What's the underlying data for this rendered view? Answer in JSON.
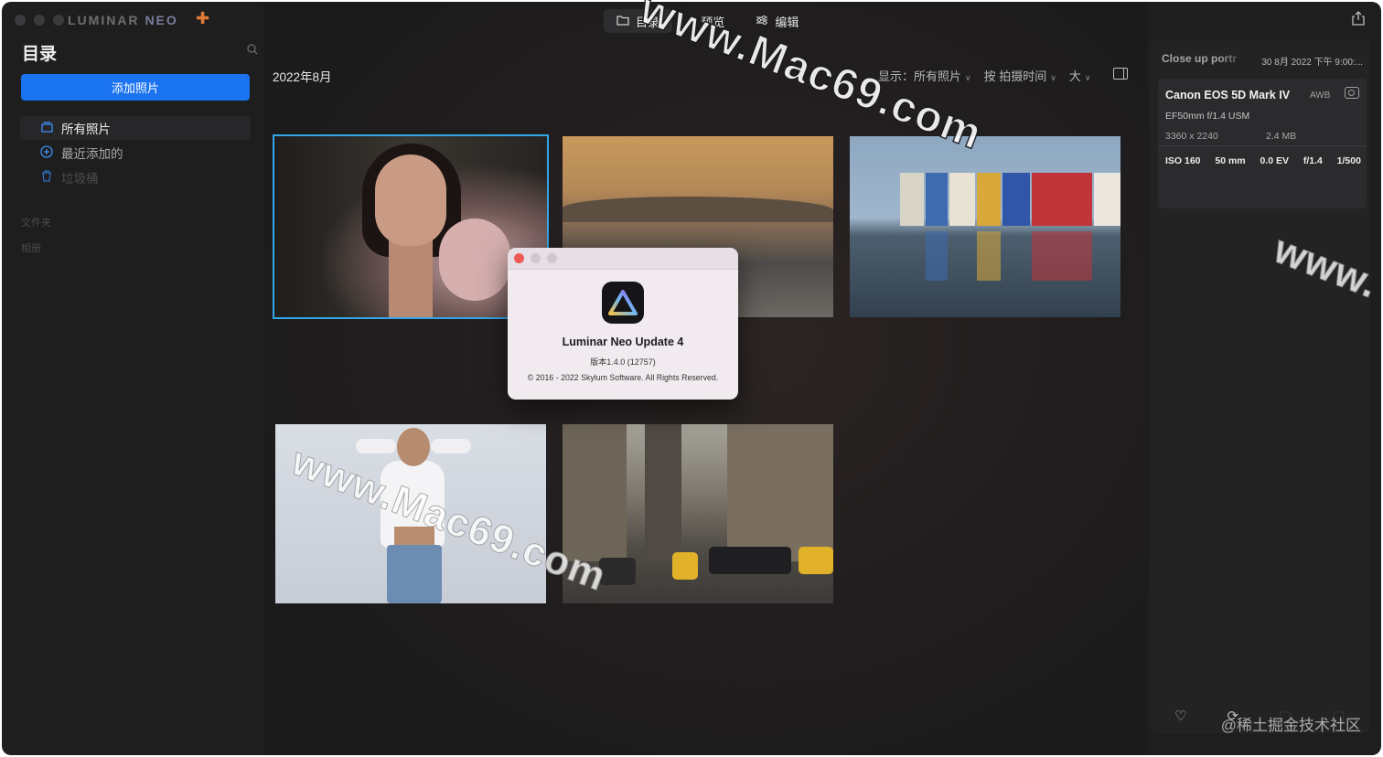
{
  "app": {
    "logo_text": "LUMINAR",
    "logo_suffix": "NEO",
    "top_tabs": [
      {
        "label": "目录",
        "icon": "folder-icon",
        "active": true
      },
      {
        "label": "预览",
        "icon": "chevron-left-icon",
        "active": false
      },
      {
        "label": "编辑",
        "icon": "sliders-icon",
        "active": false
      }
    ]
  },
  "sidebar": {
    "title": "目录",
    "add_button": "添加照片",
    "items": [
      {
        "label": "所有照片",
        "icon": "photos-icon",
        "active": true
      },
      {
        "label": "最近添加的",
        "icon": "plus-circle-icon",
        "active": false
      },
      {
        "label": "垃圾桶",
        "icon": "trash-icon",
        "active": false
      }
    ],
    "sections": [
      "文件夹",
      "相册"
    ]
  },
  "main": {
    "date_heading": "2022年8月",
    "show_label": "显示：",
    "show_value": "所有照片",
    "sort_value": "按 拍摄时间",
    "size_value": "大"
  },
  "about_dialog": {
    "app_name": "Luminar Neo Update 4",
    "version": "版本1.4.0 (12757)",
    "copyright": "© 2016 - 2022 Skylum Software. All Rights Reserved."
  },
  "info_panel": {
    "filename": "Close up portr",
    "datetime": "30 8月 2022 下午 9:00:...",
    "camera": "Canon EOS 5D Mark IV",
    "white_balance": "AWB",
    "lens": "EF50mm f/1.4 USM",
    "dimensions": "3360 x 2240",
    "file_size": "2.4 MB",
    "iso": "ISO 160",
    "focal_length": "50 mm",
    "exposure_comp": "0.0 EV",
    "aperture": "f/1.4",
    "shutter": "1/500"
  },
  "watermarks": {
    "top": "www.Mac69.com",
    "middle": "www.Mac69.com",
    "right": "www.",
    "credit": "@稀土掘金技术社区"
  },
  "colors": {
    "accent": "#1a73f0",
    "selection": "#34a6e8",
    "background": "#1e1e1f"
  }
}
